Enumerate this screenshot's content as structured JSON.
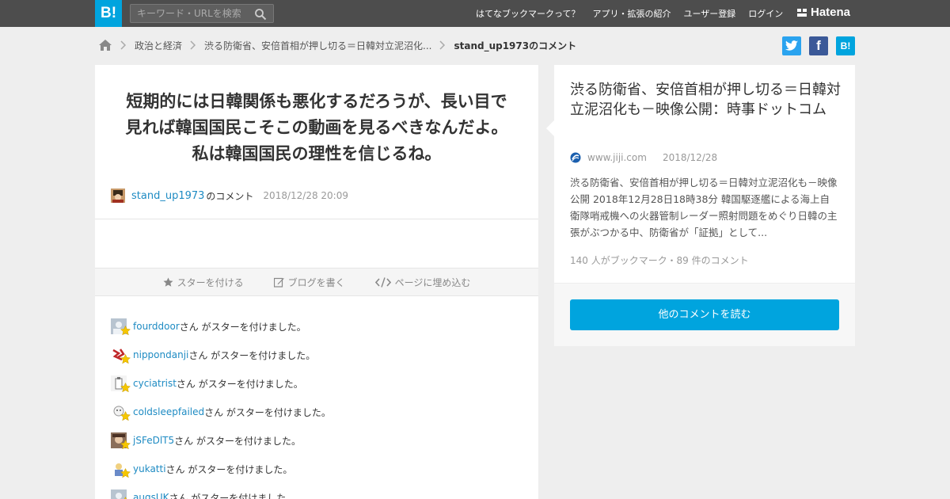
{
  "topbar": {
    "logo": "B!",
    "search_placeholder": "キーワード・URLを検索",
    "nav": [
      "はてなブックマークって？",
      "アプリ・拡張の紹介",
      "ユーザー登録",
      "ログイン"
    ],
    "brand": "Hatena"
  },
  "breadcrumb": {
    "items": [
      "政治と経済",
      "渋る防衛省、安倍首相が押し切る＝日韓対立泥沼化...",
      "stand_up1973のコメント"
    ]
  },
  "share": {
    "bookmark_label": "B!"
  },
  "comment": {
    "text": "短期的には日韓関係も悪化するだろうが、長い目で見れば韓国国民こそこの動画を見るべきなんだよ。私は韓国国民の理性を信じるね。",
    "author": "stand_up1973",
    "suffix": "のコメント",
    "date": "2018/12/28 20:09"
  },
  "actions": {
    "star": "スターを付ける",
    "blog": "ブログを書く",
    "embed": "ページに埋め込む"
  },
  "stars": {
    "suffix": "さん がスターを付けました。",
    "users": [
      "fourddoor",
      "nippondanji",
      "cyciatrist",
      "coldsleepfailed",
      "jSFeDlT5",
      "yukatti",
      "augsUK"
    ]
  },
  "entry": {
    "title": "渋る防衛省、安倍首相が押し切る＝日韓対立泥沼化も－映像公開：時事ドットコム",
    "domain": "www.jiji.com",
    "date": "2018/12/28",
    "description": "渋る防衛省、安倍首相が押し切る＝日韓対立泥沼化も－映像公開 2018年12月28日18時38分 韓国駆逐艦による海上自衛隊哨戒機への火器管制レーダー照射問題をめぐり日韓の主張がぶつかる中、防衛省が「証拠」として...",
    "stats": "140 人がブックマーク・89 件のコメント",
    "button": "他のコメントを読む"
  },
  "colors": {
    "accent": "#00a4de",
    "topbar": "#4d4d4d",
    "link": "#1e8bc3",
    "star": "#f5c600",
    "twitter": "#2aa3ef",
    "facebook": "#3b5998"
  }
}
